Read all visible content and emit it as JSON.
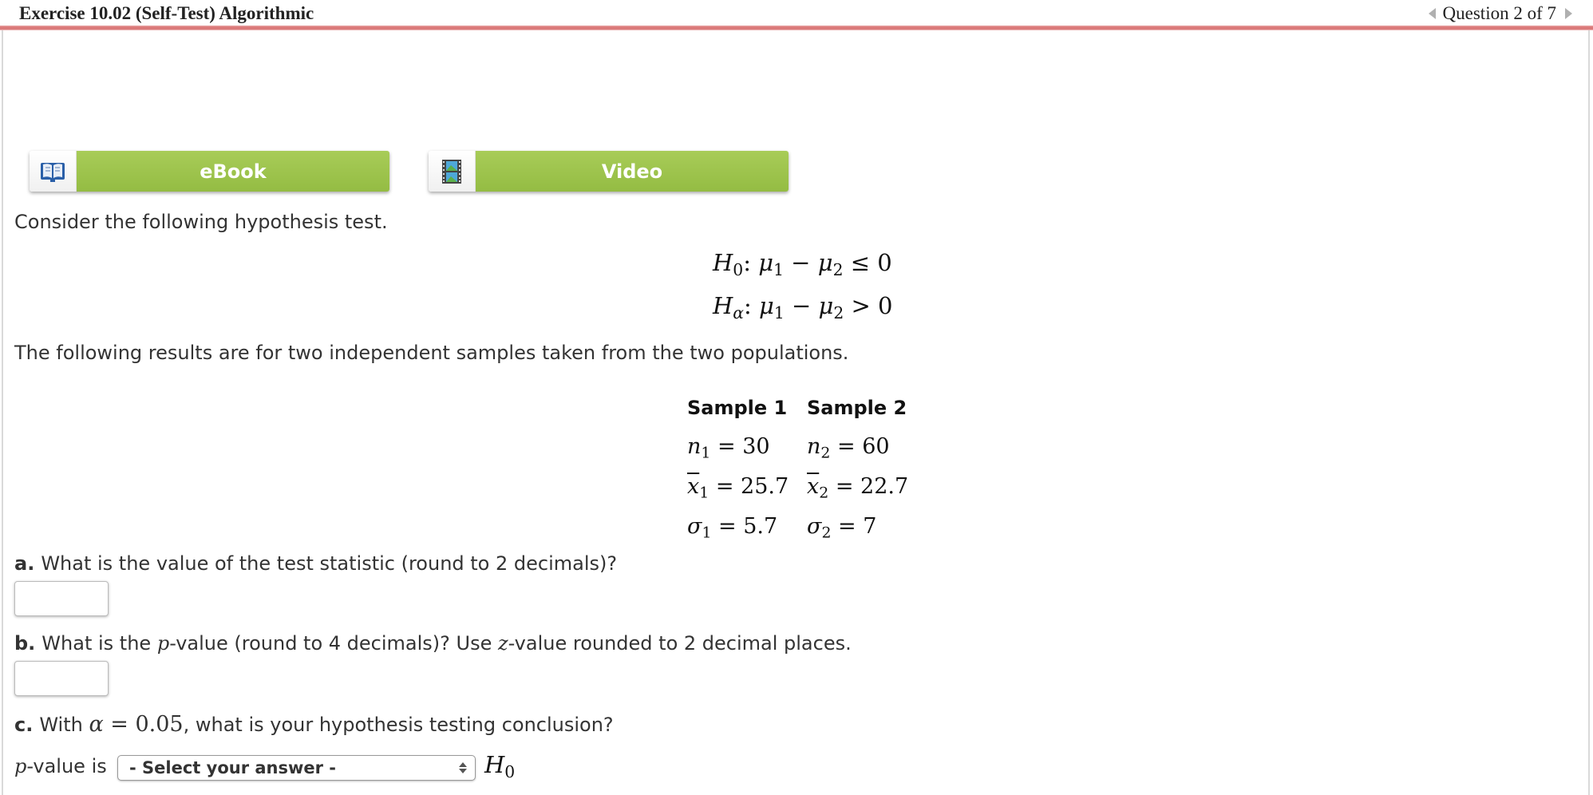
{
  "header": {
    "title": "Exercise 10.02 (Self-Test) Algorithmic",
    "question_nav": "Question 2 of 7",
    "prev_icon": "triangle-left-icon",
    "next_icon": "triangle-right-icon"
  },
  "colors": {
    "header_rule": "#d97575",
    "resource_button_green": "#9fc64f",
    "text": "#333333"
  },
  "resources": [
    {
      "label": "eBook",
      "icon": "book-icon"
    },
    {
      "label": "Video",
      "icon": "film-icon"
    }
  ],
  "intro": "Consider the following hypothesis test.",
  "hypotheses": {
    "null": {
      "H": "H",
      "sub": "0",
      "expr_mu1": "μ",
      "s1": "1",
      "minus": " − ",
      "expr_mu2": "μ",
      "s2": "2",
      "rel": " ≤ 0"
    },
    "alt": {
      "H": "H",
      "sub": "α",
      "expr_mu1": "μ",
      "s1": "1",
      "minus": " − ",
      "expr_mu2": "μ",
      "s2": "2",
      "rel": " > 0"
    }
  },
  "samples_intro": "The following results are for two independent samples taken from the two populations.",
  "samples_table": {
    "headers": [
      "Sample 1",
      "Sample 2"
    ],
    "rows": [
      [
        {
          "sym": "n",
          "sub": "1",
          "val": " = 30"
        },
        {
          "sym": "n",
          "sub": "2",
          "val": " = 60"
        }
      ],
      [
        {
          "sym": "x",
          "sub": "1",
          "val": " = 25.7"
        },
        {
          "sym": "x",
          "sub": "2",
          "val": " = 22.7"
        }
      ],
      [
        {
          "sym": "σ",
          "sub": "1",
          "val": " = 5.7"
        },
        {
          "sym": "σ",
          "sub": "2",
          "val": " = 7"
        }
      ]
    ]
  },
  "questions": {
    "a": {
      "label": "a.",
      "text": "What is the value of the test statistic (round to 2 decimals)?",
      "value": ""
    },
    "b": {
      "label": "b.",
      "text_1": "What is the ",
      "p": "p",
      "text_2": "-value (round to 4 decimals)? Use ",
      "z": "z",
      "text_3": "-value rounded to 2 decimal places.",
      "value": ""
    },
    "c": {
      "label": "c.",
      "text_1": "With ",
      "alpha": "α",
      "eq": " = 0.05",
      "text_2": ", what is your hypothesis testing conclusion?",
      "p": "p",
      "prefix": "-value is",
      "select_value": "- Select your answer -",
      "suffix_H": "H",
      "suffix_sub": "0"
    }
  }
}
